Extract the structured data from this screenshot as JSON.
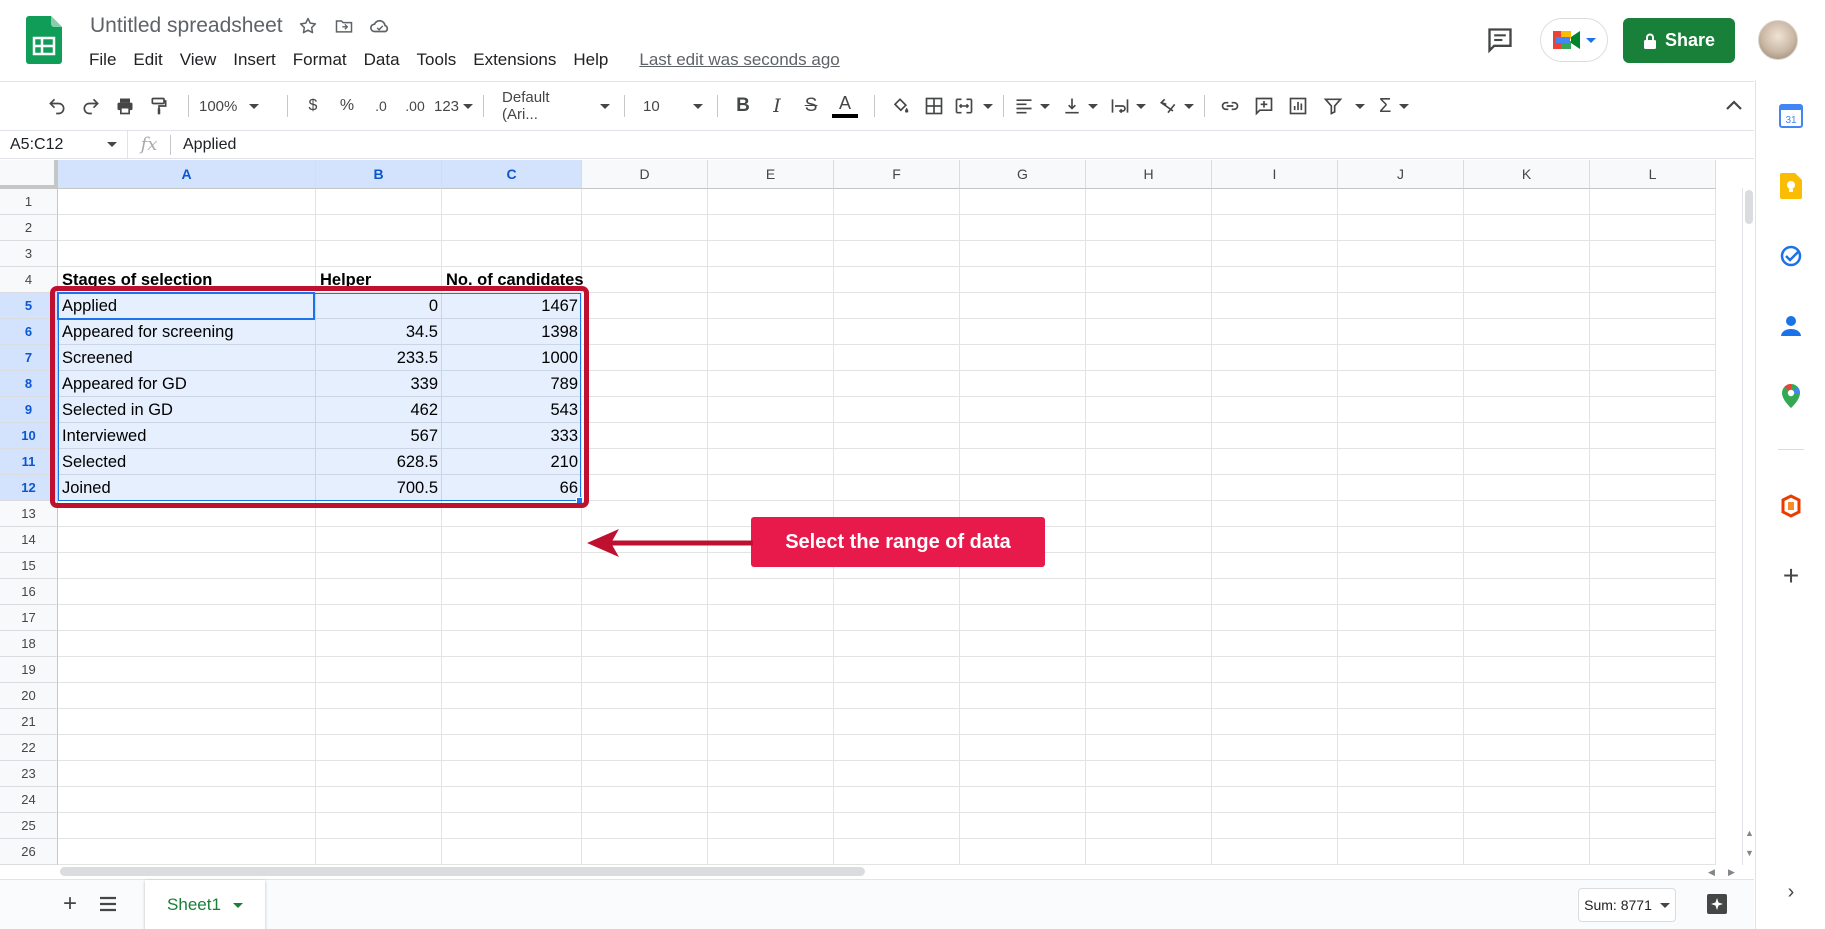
{
  "app": {
    "doc_title": "Untitled spreadsheet",
    "menus": [
      "File",
      "Edit",
      "View",
      "Insert",
      "Format",
      "Data",
      "Tools",
      "Extensions",
      "Help"
    ],
    "last_edit": "Last edit was seconds ago",
    "share_label": "Share"
  },
  "toolbar": {
    "zoom": "100%",
    "currency": "$",
    "percent": "%",
    "decrease_decimal": ".0",
    "increase_decimal": ".00",
    "more_formats": "123",
    "font": "Default (Ari...",
    "font_size": "10",
    "text_color": "#000000",
    "accent": "#188038"
  },
  "formula_bar": {
    "name_box": "A5:C12",
    "fx": "fx",
    "value": "Applied"
  },
  "grid": {
    "columns": [
      "A",
      "B",
      "C",
      "D",
      "E",
      "F",
      "G",
      "H",
      "I",
      "J",
      "K",
      "L"
    ],
    "rows": [
      "1",
      "2",
      "3",
      "4",
      "5",
      "6",
      "7",
      "8",
      "9",
      "10",
      "11",
      "12",
      "13",
      "14",
      "15",
      "16",
      "17",
      "18",
      "19",
      "20",
      "21",
      "22",
      "23",
      "24",
      "25",
      "26"
    ],
    "header_row": {
      "a": "Stages of selection",
      "b": "Helper",
      "c": "No. of candidates"
    },
    "data_rows": [
      {
        "a": "Applied",
        "b": "0",
        "c": "1467"
      },
      {
        "a": "Appeared for screening",
        "b": "34.5",
        "c": "1398"
      },
      {
        "a": "Screened",
        "b": "233.5",
        "c": "1000"
      },
      {
        "a": "Appeared for GD",
        "b": "339",
        "c": "789"
      },
      {
        "a": "Selected in GD",
        "b": "462",
        "c": "543"
      },
      {
        "a": "Interviewed",
        "b": "567",
        "c": "333"
      },
      {
        "a": "Selected",
        "b": "628.5",
        "c": "210"
      },
      {
        "a": "Joined",
        "b": "700.5",
        "c": "66"
      }
    ]
  },
  "annotation": {
    "callout_text": "Select the range of data",
    "callout_color": "#e8194b",
    "frame_color": "#c0102f"
  },
  "bottom_bar": {
    "sheet_name": "Sheet1",
    "sum_label": "Sum: 8771"
  },
  "side_panel": {
    "calendar_day": "31"
  }
}
